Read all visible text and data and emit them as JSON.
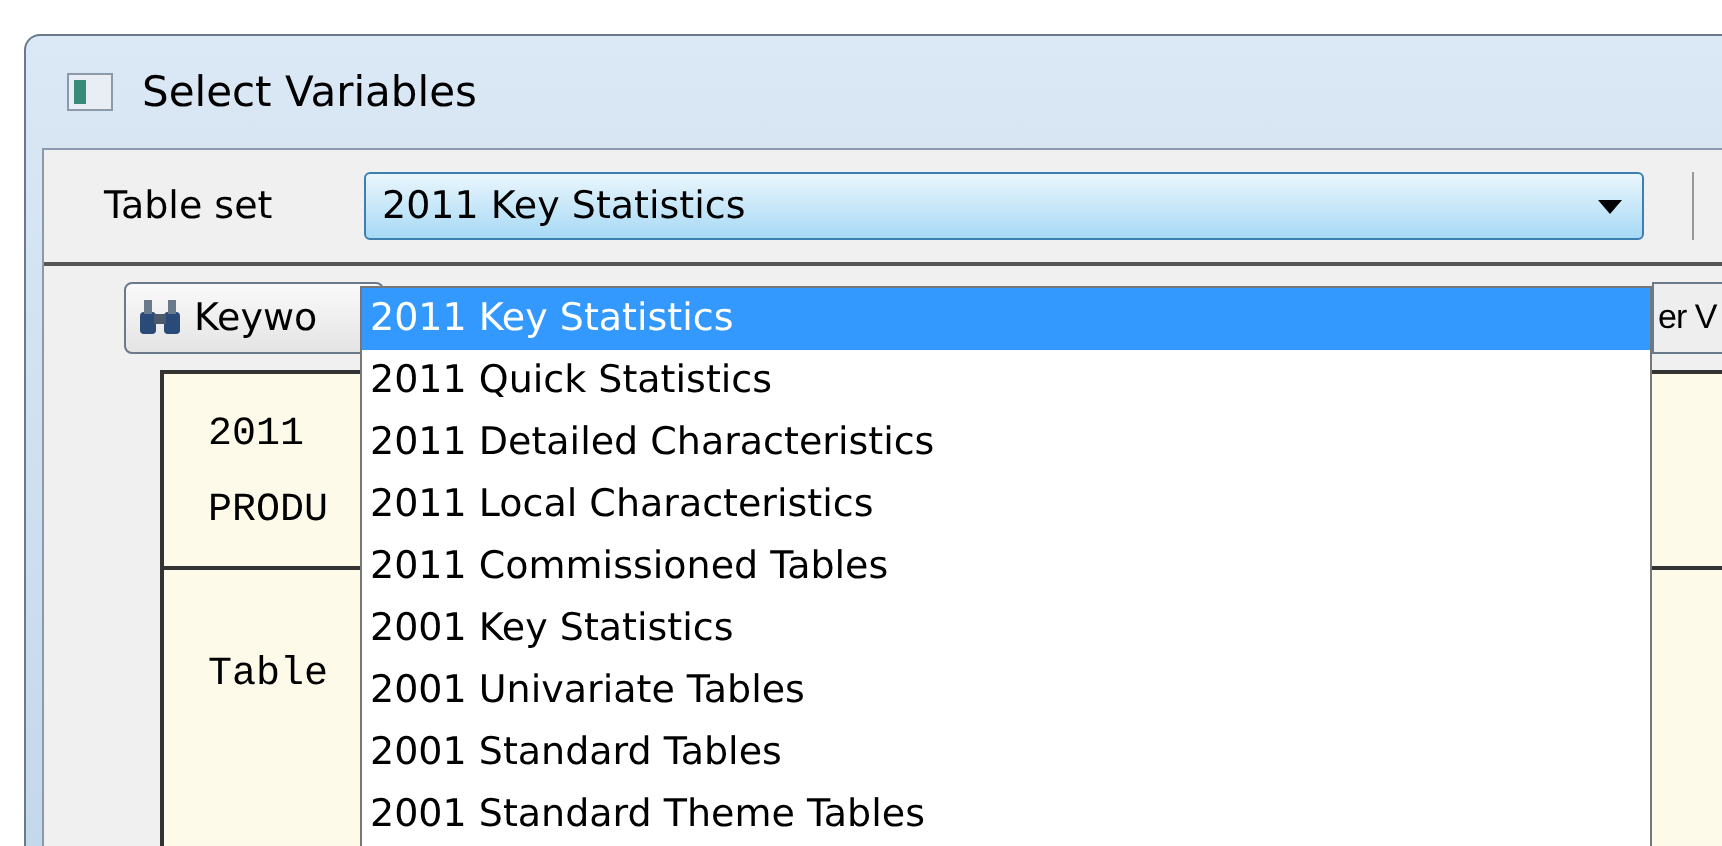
{
  "window": {
    "title": "Select Variables"
  },
  "table_set": {
    "label": "Table set",
    "value": "2011 Key Statistics",
    "expanded": true,
    "options": [
      {
        "label": "2011 Key Statistics",
        "selected": true
      },
      {
        "label": "2011 Quick Statistics",
        "selected": false
      },
      {
        "label": "2011 Detailed Characteristics",
        "selected": false
      },
      {
        "label": "2011 Local Characteristics",
        "selected": false
      },
      {
        "label": "2011 Commissioned Tables",
        "selected": false
      },
      {
        "label": "2001 Key Statistics",
        "selected": false
      },
      {
        "label": "2001 Univariate Tables",
        "selected": false
      },
      {
        "label": "2001 Standard Tables",
        "selected": false
      },
      {
        "label": "2001 Standard Theme Tables",
        "selected": false
      }
    ]
  },
  "keyword_button": {
    "label": "Keywo"
  },
  "right_button": {
    "label": "er V"
  },
  "panel": {
    "lines": [
      "2011",
      "PRODU",
      "Table"
    ]
  }
}
